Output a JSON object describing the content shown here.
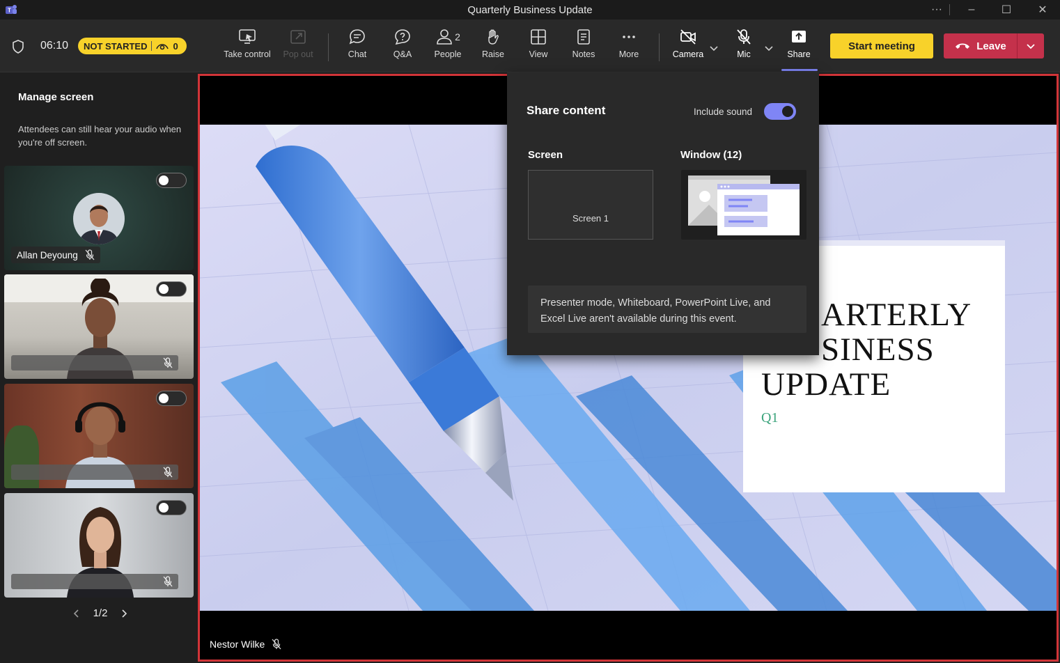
{
  "window": {
    "title": "Quarterly Business Update"
  },
  "status": {
    "timer": "06:10",
    "badge_label": "NOT STARTED",
    "viewers": "0"
  },
  "toolbar": {
    "take_control": "Take control",
    "pop_out": "Pop out",
    "chat": "Chat",
    "qa": "Q&A",
    "people": "People",
    "people_count": "2",
    "raise": "Raise",
    "view": "View",
    "notes": "Notes",
    "more": "More",
    "camera": "Camera",
    "mic": "Mic",
    "share": "Share",
    "start_meeting": "Start meeting",
    "leave": "Leave"
  },
  "sidebar": {
    "title": "Manage screen",
    "note": "Attendees can still hear your audio when you're off screen.",
    "participants": [
      {
        "name": "Allan Deyoung"
      },
      {
        "name": ""
      },
      {
        "name": ""
      },
      {
        "name": ""
      }
    ],
    "pager": "1/2"
  },
  "share_panel": {
    "title": "Share content",
    "include_sound_label": "Include sound",
    "include_sound": true,
    "screen_label": "Screen",
    "screen_item": "Screen 1",
    "window_label": "Window (12)",
    "notice": "Presenter mode, Whiteboard, PowerPoint Live, and Excel Live aren't available during this event."
  },
  "slide": {
    "title_line1": "ARTERLY",
    "title_line2": "SINESS",
    "title_line3": "UPDATE",
    "subtitle": "Q1"
  },
  "stage": {
    "presenter_name": "Nestor Wilke"
  },
  "colors": {
    "accent": "#7f85f5",
    "leave": "#c4314b",
    "badge": "#f8d22a",
    "stage_border": "#d13438"
  }
}
